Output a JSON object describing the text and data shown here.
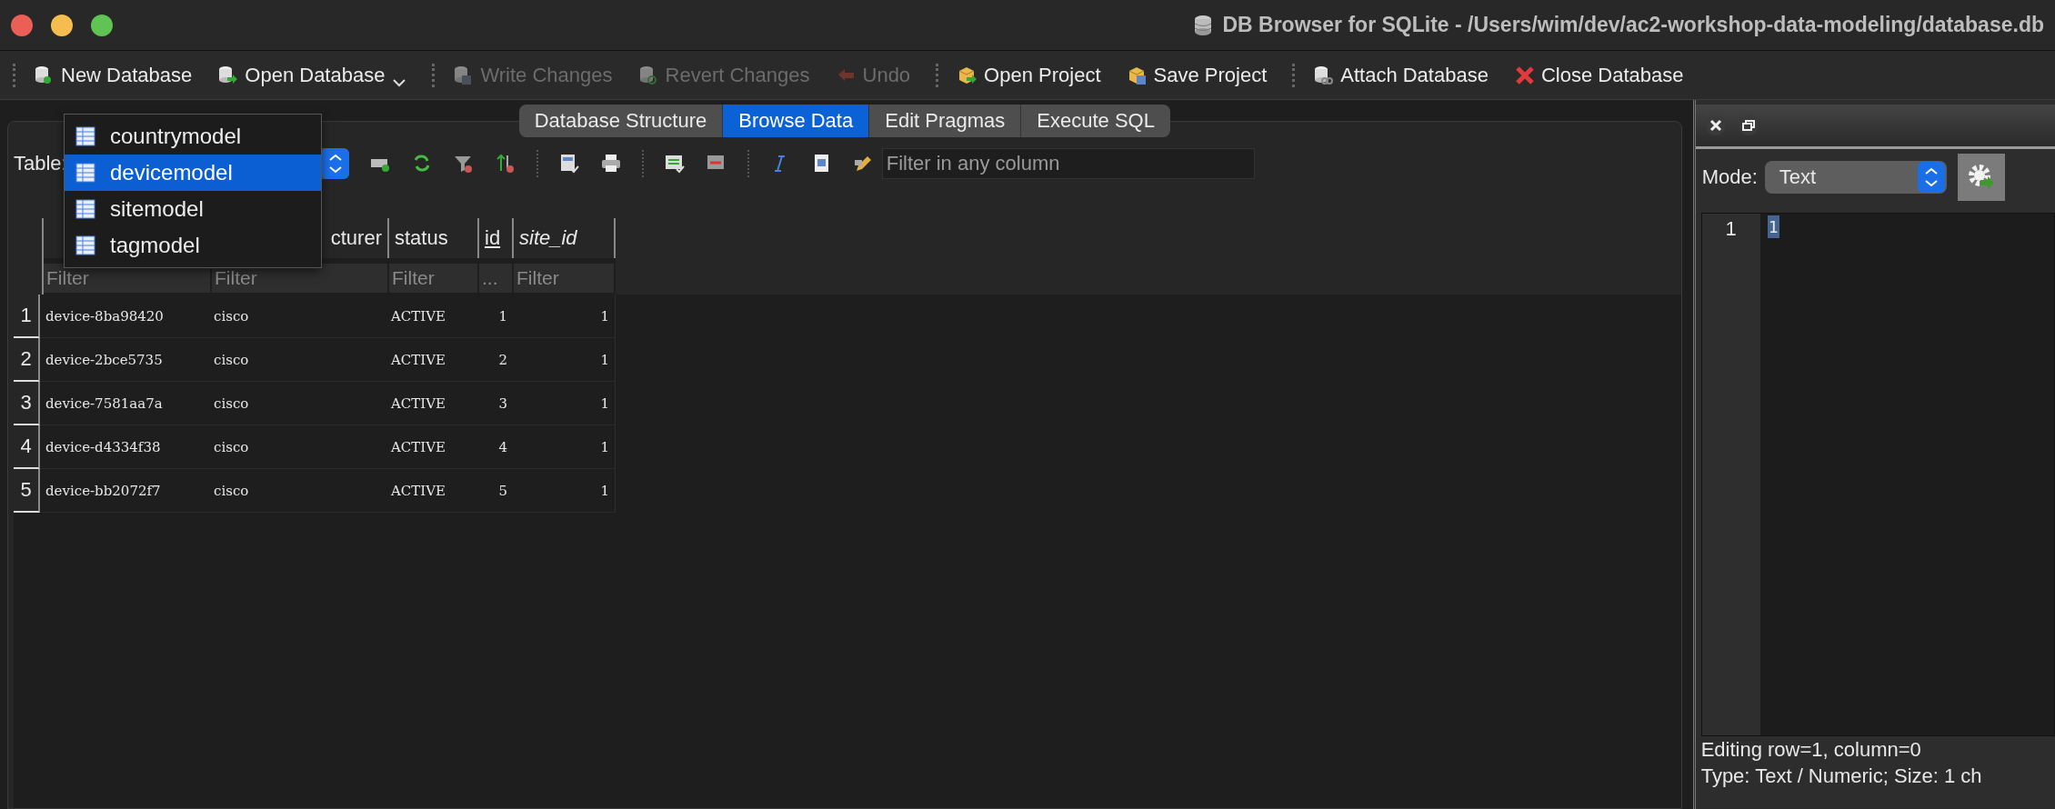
{
  "window": {
    "title": "DB Browser for SQLite - /Users/wim/dev/ac2-workshop-data-modeling/database.db"
  },
  "toolbar": [
    {
      "label": "New Database",
      "disabled": false,
      "menu": false
    },
    {
      "label": "Open Database",
      "disabled": false,
      "menu": true
    },
    {
      "label": "Write Changes",
      "disabled": true,
      "menu": false
    },
    {
      "label": "Revert Changes",
      "disabled": true,
      "menu": false
    },
    {
      "label": "Undo",
      "disabled": true,
      "menu": false
    },
    {
      "label": "Open Project",
      "disabled": false,
      "menu": false
    },
    {
      "label": "Save Project",
      "disabled": false,
      "menu": false
    },
    {
      "label": "Attach Database",
      "disabled": false,
      "menu": false
    },
    {
      "label": "Close Database",
      "disabled": false,
      "menu": false
    }
  ],
  "tabs": [
    {
      "label": "Database Structure",
      "selected": false
    },
    {
      "label": "Browse Data",
      "selected": true
    },
    {
      "label": "Edit Pragmas",
      "selected": false
    },
    {
      "label": "Execute SQL",
      "selected": false
    }
  ],
  "table_bar": {
    "label": "Table:",
    "filter_placeholder": "Filter in any column"
  },
  "table_list": [
    {
      "label": "countrymodel",
      "selected": false
    },
    {
      "label": "devicemodel",
      "selected": true
    },
    {
      "label": "sitemodel",
      "selected": false
    },
    {
      "label": "tagmodel",
      "selected": false
    }
  ],
  "columns": [
    {
      "placeholder": "Filter"
    },
    {
      "label": "cturer",
      "placeholder": "Filter",
      "primary_key": false,
      "foreign_key": false
    },
    {
      "label": "status",
      "placeholder": "Filter",
      "primary_key": false,
      "foreign_key": false
    },
    {
      "label": "id",
      "placeholder": "...",
      "primary_key": true,
      "foreign_key": false
    },
    {
      "label": "site_id",
      "placeholder": "Filter",
      "primary_key": false,
      "foreign_key": true
    }
  ],
  "rows": [
    {
      "number": "1",
      "cells": [
        "device-8ba98420",
        "cisco",
        "ACTIVE",
        "1",
        "1"
      ]
    },
    {
      "number": "2",
      "cells": [
        "device-2bce5735",
        "cisco",
        "ACTIVE",
        "2",
        "1"
      ]
    },
    {
      "number": "3",
      "cells": [
        "device-7581aa7a",
        "cisco",
        "ACTIVE",
        "3",
        "1"
      ]
    },
    {
      "number": "4",
      "cells": [
        "device-d4334f38",
        "cisco",
        "ACTIVE",
        "4",
        "1"
      ]
    },
    {
      "number": "5",
      "cells": [
        "device-bb2072f7",
        "cisco",
        "ACTIVE",
        "5",
        "1"
      ]
    }
  ],
  "editor": {
    "mode_label": "Mode:",
    "mode": "Text",
    "lines": [
      {
        "number": "1",
        "text": "1",
        "selected": true
      }
    ],
    "status": [
      "Editing row=1, column=0",
      "Type: Text / Numeric; Size: 1 ch"
    ]
  }
}
